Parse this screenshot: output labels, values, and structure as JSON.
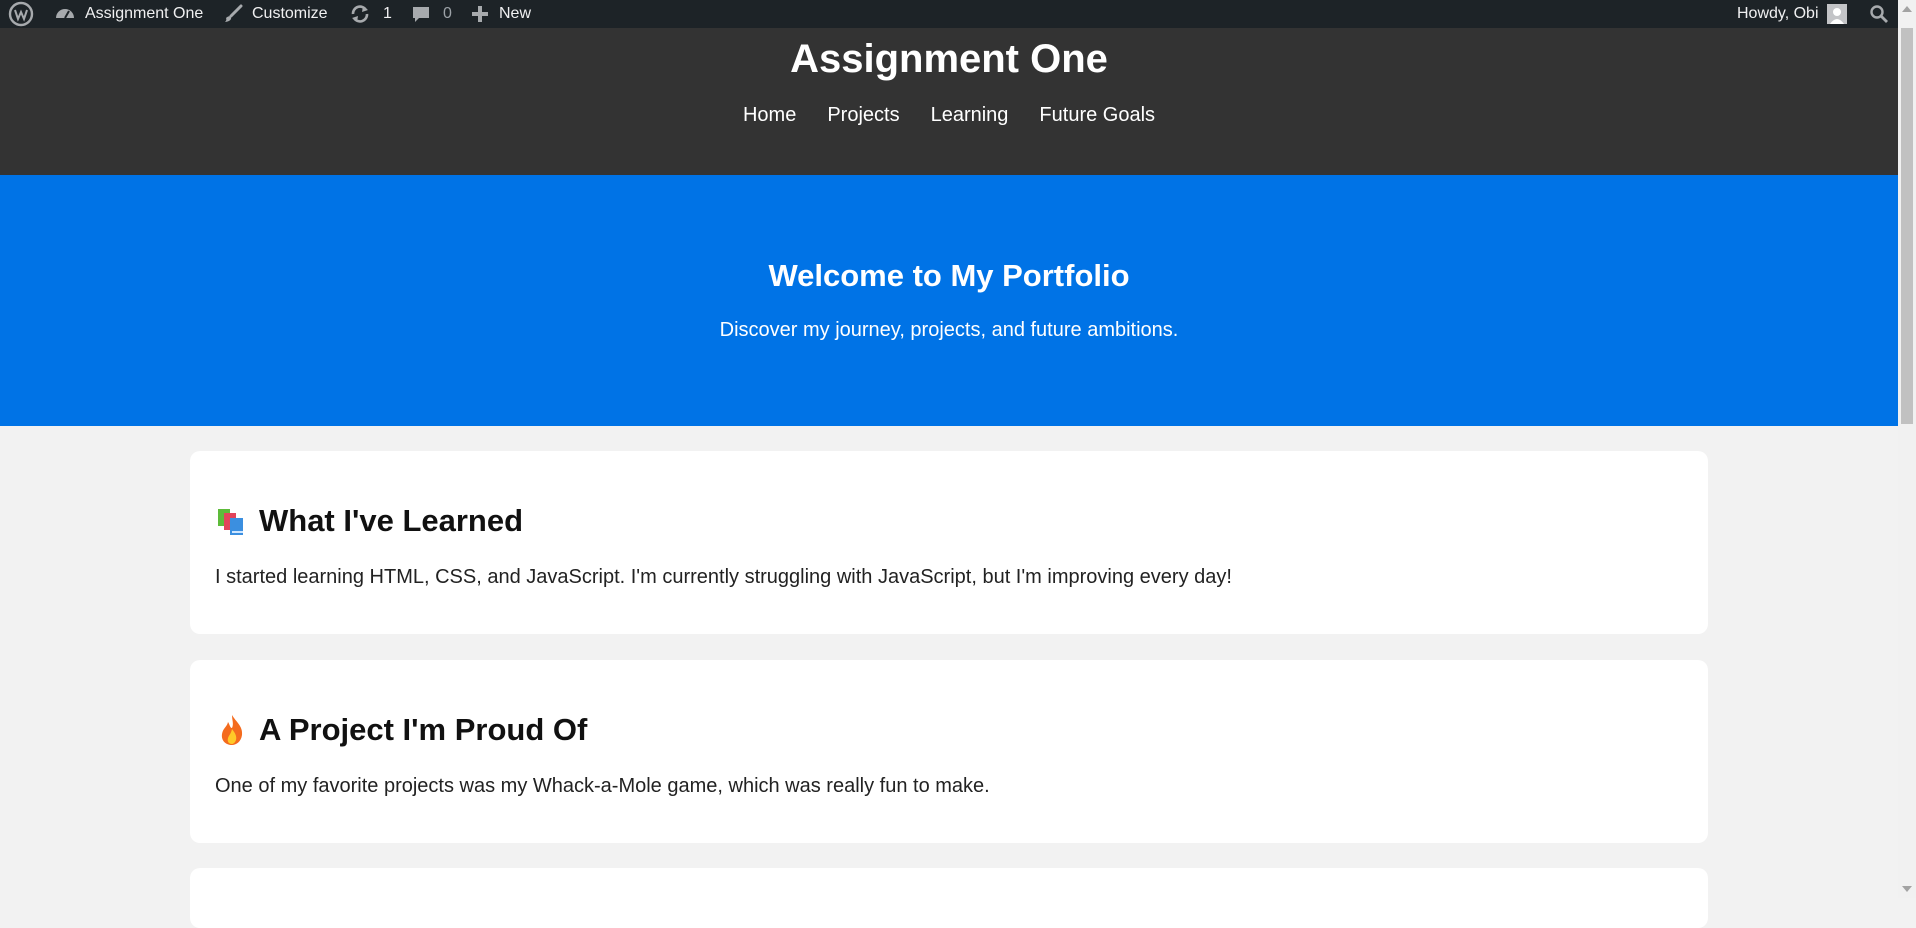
{
  "admin_bar": {
    "site_name": "Assignment One",
    "customize": "Customize",
    "updates_count": "1",
    "comments_count": "0",
    "new_label": "New",
    "greeting": "Howdy, Obi",
    "icons": [
      "wordpress-icon",
      "dashboard-icon",
      "brush-icon",
      "refresh-icon",
      "comment-icon",
      "plus-icon",
      "avatar-icon",
      "search-icon"
    ]
  },
  "header": {
    "site_title": "Assignment One",
    "nav": [
      "Home",
      "Projects",
      "Learning",
      "Future Goals"
    ]
  },
  "hero": {
    "title": "Welcome to My Portfolio",
    "subtitle": "Discover my journey, projects, and future ambitions."
  },
  "sections": [
    {
      "icon": "books-icon",
      "title": "What I've Learned",
      "text": "I started learning HTML, CSS, and JavaScript. I'm currently struggling with JavaScript, but I'm improving every day!"
    },
    {
      "icon": "fire-icon",
      "title": "A Project I'm Proud Of",
      "text": "One of my favorite projects was my Whack-a-Mole game, which was really fun to make."
    }
  ],
  "colors": {
    "admin_bar": "#1d2327",
    "header": "#333333",
    "hero": "#0073e6",
    "page_bg": "#f2f2f2",
    "card": "#ffffff"
  }
}
